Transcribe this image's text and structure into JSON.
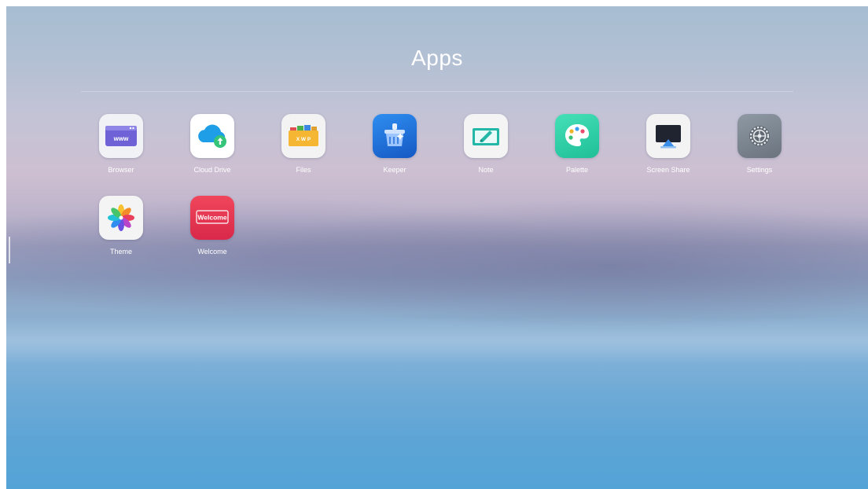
{
  "page": {
    "title": "Apps"
  },
  "apps": [
    {
      "label": "Browser",
      "icon": "browser-icon",
      "icon_text": "www",
      "tile_color": "#f1f2f6"
    },
    {
      "label": "Cloud Drive",
      "icon": "cloud-drive-icon",
      "tile_color": "#ffffff"
    },
    {
      "label": "Files",
      "icon": "files-icon",
      "icon_text": "X W P",
      "tile_color": "#f3f3f3"
    },
    {
      "label": "Keeper",
      "icon": "keeper-icon",
      "tile_color": "#1f6fd8"
    },
    {
      "label": "Note",
      "icon": "note-icon",
      "tile_color": "#f4f4f4"
    },
    {
      "label": "Palette",
      "icon": "palette-icon",
      "tile_color": "#2fd3a8"
    },
    {
      "label": "Screen Share",
      "icon": "screen-share-icon",
      "tile_color": "#f3f3f3"
    },
    {
      "label": "Settings",
      "icon": "settings-icon",
      "tile_color": "#7e8790"
    },
    {
      "label": "Theme",
      "icon": "theme-icon",
      "tile_color": "#f4f4f4"
    },
    {
      "label": "Welcome",
      "icon": "welcome-icon",
      "icon_text": "Welcome",
      "tile_color": "#e8344f"
    }
  ]
}
